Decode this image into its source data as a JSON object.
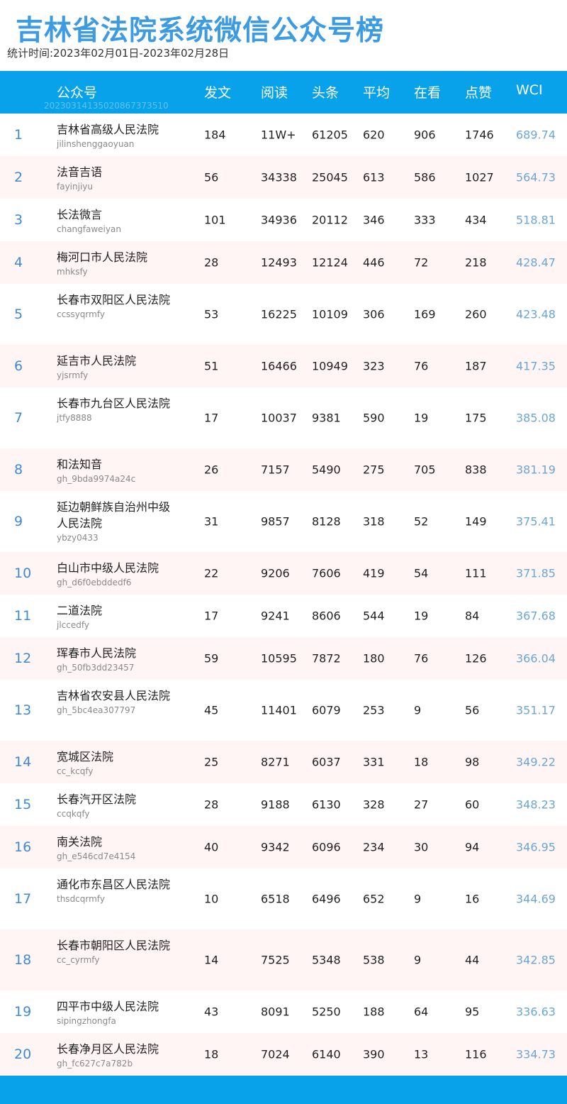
{
  "title": "吉林省法院系统微信公众号榜",
  "period": "统计时间:2023年02月01日-2023年02月28日",
  "header": {
    "account": "公众号",
    "posts": "发文",
    "reads": "阅读",
    "headline": "头条",
    "avg": "平均",
    "looking": "在看",
    "likes": "点赞",
    "wci": "WCI",
    "watermark": "20230314135020867373510"
  },
  "rows": [
    {
      "rank": "1",
      "name": "吉林省高级人民法院",
      "account": "jilinshenggaoyuan",
      "posts": "184",
      "reads": "11W+",
      "headline": "61205",
      "avg": "620",
      "looking": "906",
      "likes": "1746",
      "wci": "689.74"
    },
    {
      "rank": "2",
      "name": "法音吉语",
      "account": "fayinjiyu",
      "posts": "56",
      "reads": "34338",
      "headline": "25045",
      "avg": "613",
      "looking": "586",
      "likes": "1027",
      "wci": "564.73"
    },
    {
      "rank": "3",
      "name": "长法微言",
      "account": "changfaweiyan",
      "posts": "101",
      "reads": "34936",
      "headline": "20112",
      "avg": "346",
      "looking": "333",
      "likes": "434",
      "wci": "518.81"
    },
    {
      "rank": "4",
      "name": "梅河口市人民法院",
      "account": "mhksfy",
      "posts": "28",
      "reads": "12493",
      "headline": "12124",
      "avg": "446",
      "looking": "72",
      "likes": "218",
      "wci": "428.47"
    },
    {
      "rank": "5",
      "name": "长春市双阳区人民法院",
      "account": "ccssyqrmfy",
      "posts": "53",
      "reads": "16225",
      "headline": "10109",
      "avg": "306",
      "looking": "169",
      "likes": "260",
      "wci": "423.48"
    },
    {
      "rank": "6",
      "name": "延吉市人民法院",
      "account": "yjsrmfy",
      "posts": "51",
      "reads": "16466",
      "headline": "10949",
      "avg": "323",
      "looking": "76",
      "likes": "187",
      "wci": "417.35"
    },
    {
      "rank": "7",
      "name": "长春市九台区人民法院",
      "account": "jtfy8888",
      "posts": "17",
      "reads": "10037",
      "headline": "9381",
      "avg": "590",
      "looking": "19",
      "likes": "175",
      "wci": "385.08"
    },
    {
      "rank": "8",
      "name": "和法知音",
      "account": "gh_9bda9974a24c",
      "posts": "26",
      "reads": "7157",
      "headline": "5490",
      "avg": "275",
      "looking": "705",
      "likes": "838",
      "wci": "381.19"
    },
    {
      "rank": "9",
      "name": "延边朝鲜族自治州中级人民法院",
      "account": "ybzy0433",
      "posts": "31",
      "reads": "9857",
      "headline": "8128",
      "avg": "318",
      "looking": "52",
      "likes": "149",
      "wci": "375.41"
    },
    {
      "rank": "10",
      "name": "白山市中级人民法院",
      "account": "gh_d6f0ebddedf6",
      "posts": "22",
      "reads": "9206",
      "headline": "7606",
      "avg": "419",
      "looking": "54",
      "likes": "111",
      "wci": "371.85"
    },
    {
      "rank": "11",
      "name": "二道法院",
      "account": "jlccedfy",
      "posts": "17",
      "reads": "9241",
      "headline": "8606",
      "avg": "544",
      "looking": "19",
      "likes": "84",
      "wci": "367.68"
    },
    {
      "rank": "12",
      "name": "珲春市人民法院",
      "account": "gh_50fb3dd23457",
      "posts": "59",
      "reads": "10595",
      "headline": "7872",
      "avg": "180",
      "looking": "76",
      "likes": "126",
      "wci": "366.04"
    },
    {
      "rank": "13",
      "name": "吉林省农安县人民法院",
      "account": "gh_5bc4ea307797",
      "posts": "45",
      "reads": "11401",
      "headline": "6079",
      "avg": "253",
      "looking": "9",
      "likes": "56",
      "wci": "351.17"
    },
    {
      "rank": "14",
      "name": "宽城区法院",
      "account": "cc_kcqfy",
      "posts": "25",
      "reads": "8271",
      "headline": "6037",
      "avg": "331",
      "looking": "18",
      "likes": "98",
      "wci": "349.22"
    },
    {
      "rank": "15",
      "name": "长春汽开区法院",
      "account": "ccqkqfy",
      "posts": "28",
      "reads": "9188",
      "headline": "6130",
      "avg": "328",
      "looking": "27",
      "likes": "60",
      "wci": "348.23"
    },
    {
      "rank": "16",
      "name": "南关法院",
      "account": "gh_e546cd7e4154",
      "posts": "40",
      "reads": "9342",
      "headline": "6096",
      "avg": "234",
      "looking": "30",
      "likes": "94",
      "wci": "346.95"
    },
    {
      "rank": "17",
      "name": "通化市东昌区人民法院",
      "account": "thsdcqrmfy",
      "posts": "10",
      "reads": "6518",
      "headline": "6496",
      "avg": "652",
      "looking": "9",
      "likes": "16",
      "wci": "344.69"
    },
    {
      "rank": "18",
      "name": "长春市朝阳区人民法院",
      "account": "cc_cyrmfy",
      "posts": "14",
      "reads": "7525",
      "headline": "5348",
      "avg": "538",
      "looking": "9",
      "likes": "44",
      "wci": "342.85"
    },
    {
      "rank": "19",
      "name": "四平市中级人民法院",
      "account": "sipingzhongfa",
      "posts": "43",
      "reads": "8091",
      "headline": "5250",
      "avg": "188",
      "looking": "64",
      "likes": "95",
      "wci": "336.63"
    },
    {
      "rank": "20",
      "name": "长春净月区人民法院",
      "account": "gh_fc627c7a782b",
      "posts": "18",
      "reads": "7024",
      "headline": "6140",
      "avg": "390",
      "looking": "13",
      "likes": "116",
      "wci": "334.73"
    }
  ],
  "colors": {
    "title": "#3d9be1",
    "header_bg": "#08a2ea",
    "alt_row_bg": "#fff5f5",
    "rank": "#3d8ad6",
    "wci": "#6aa6d6"
  }
}
